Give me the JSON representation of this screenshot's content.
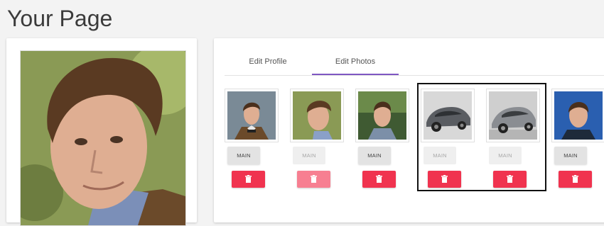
{
  "page": {
    "title": "Your Page"
  },
  "tabs": [
    {
      "label": "Edit Profile",
      "active": false
    },
    {
      "label": "Edit Photos",
      "active": true
    }
  ],
  "photos": [
    {
      "subject": "man-bowtie",
      "main_label": "MAIN",
      "main_state": "enabled",
      "delete_state": "enabled",
      "selected": false
    },
    {
      "subject": "man-closeup",
      "main_label": "MAIN",
      "main_state": "disabled",
      "delete_state": "disabled",
      "selected": false
    },
    {
      "subject": "man-outdoor",
      "main_label": "MAIN",
      "main_state": "enabled",
      "delete_state": "enabled",
      "selected": false
    },
    {
      "subject": "car",
      "main_label": "MAIN",
      "main_state": "disabled",
      "delete_state": "enabled",
      "selected": true
    },
    {
      "subject": "car",
      "main_label": "MAIN",
      "main_state": "disabled",
      "delete_state": "enabled",
      "selected": true
    },
    {
      "subject": "man-blue-bg",
      "main_label": "MAIN",
      "main_state": "enabled",
      "delete_state": "enabled",
      "selected": false
    }
  ],
  "colors": {
    "tab_accent": "#7e57c2",
    "delete": "#f0334f",
    "delete_disabled": "#f77f91"
  },
  "icons": {
    "delete": "trash-icon"
  }
}
